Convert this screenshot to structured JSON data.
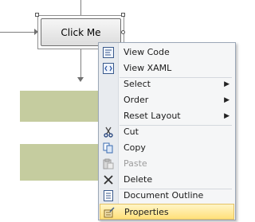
{
  "canvas": {
    "button_text": "Click Me"
  },
  "menu": {
    "items": [
      {
        "label": "View Code",
        "icon": "view-code-icon",
        "enabled": true
      },
      {
        "label": "View XAML",
        "icon": "view-xaml-icon",
        "enabled": true
      },
      {
        "label": "Select",
        "icon": "",
        "enabled": true,
        "submenu": true
      },
      {
        "label": "Order",
        "icon": "",
        "enabled": true,
        "submenu": true
      },
      {
        "label": "Reset Layout",
        "icon": "",
        "enabled": true,
        "submenu": true
      },
      {
        "label": "Cut",
        "icon": "scissors-icon",
        "enabled": true
      },
      {
        "label": "Copy",
        "icon": "copy-icon",
        "enabled": true
      },
      {
        "label": "Paste",
        "icon": "paste-icon",
        "enabled": false
      },
      {
        "label": "Delete",
        "icon": "delete-x-icon",
        "enabled": true
      },
      {
        "label": "Document Outline",
        "icon": "document-outline-icon",
        "enabled": true
      },
      {
        "label": "Properties",
        "icon": "properties-icon",
        "enabled": true,
        "highlighted": true
      }
    ]
  },
  "colors": {
    "highlight": "#ffe07a",
    "band": "#c5cc9f"
  }
}
